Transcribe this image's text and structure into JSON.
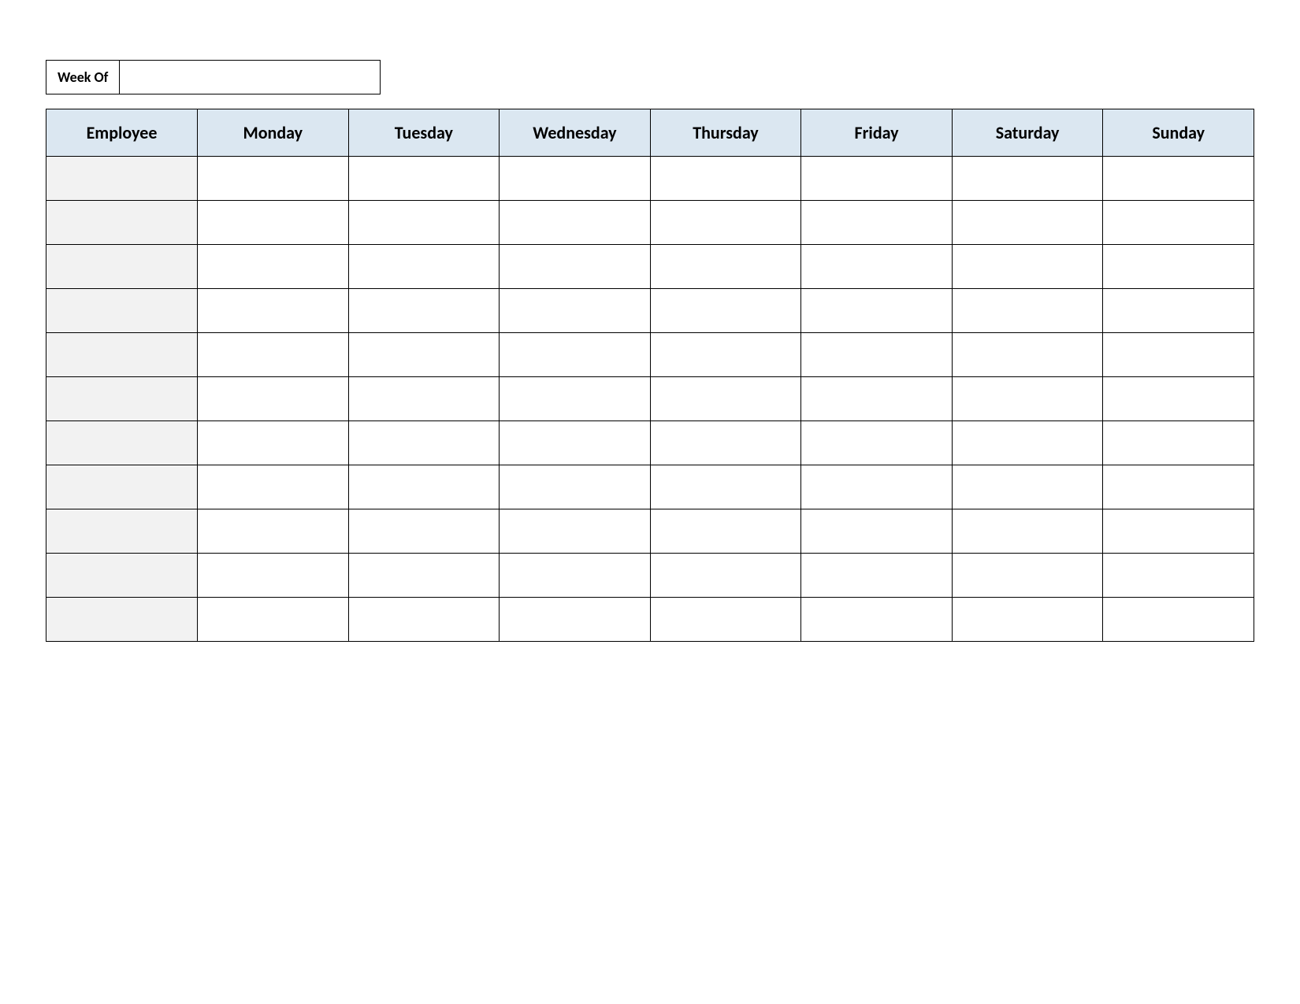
{
  "week_of": {
    "label": "Week Of",
    "value": ""
  },
  "headers": {
    "employee": "Employee",
    "days": [
      "Monday",
      "Tuesday",
      "Wednesday",
      "Thursday",
      "Friday",
      "Saturday",
      "Sunday"
    ]
  },
  "rows": [
    {
      "employee": "",
      "days": [
        "",
        "",
        "",
        "",
        "",
        "",
        ""
      ]
    },
    {
      "employee": "",
      "days": [
        "",
        "",
        "",
        "",
        "",
        "",
        ""
      ]
    },
    {
      "employee": "",
      "days": [
        "",
        "",
        "",
        "",
        "",
        "",
        ""
      ]
    },
    {
      "employee": "",
      "days": [
        "",
        "",
        "",
        "",
        "",
        "",
        ""
      ]
    },
    {
      "employee": "",
      "days": [
        "",
        "",
        "",
        "",
        "",
        "",
        ""
      ]
    },
    {
      "employee": "",
      "days": [
        "",
        "",
        "",
        "",
        "",
        "",
        ""
      ]
    },
    {
      "employee": "",
      "days": [
        "",
        "",
        "",
        "",
        "",
        "",
        ""
      ]
    },
    {
      "employee": "",
      "days": [
        "",
        "",
        "",
        "",
        "",
        "",
        ""
      ]
    },
    {
      "employee": "",
      "days": [
        "",
        "",
        "",
        "",
        "",
        "",
        ""
      ]
    },
    {
      "employee": "",
      "days": [
        "",
        "",
        "",
        "",
        "",
        "",
        ""
      ]
    },
    {
      "employee": "",
      "days": [
        "",
        "",
        "",
        "",
        "",
        "",
        ""
      ]
    }
  ]
}
